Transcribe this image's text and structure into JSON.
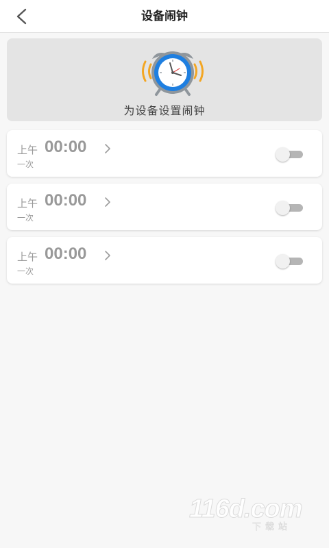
{
  "header": {
    "title": "设备闹钟",
    "back_icon": "chevron-left-icon"
  },
  "banner": {
    "icon": "alarm-clock-icon",
    "text": "为设备设置闹钟"
  },
  "alarms": [
    {
      "period": "上午",
      "time": "00:00",
      "repeat": "一次",
      "enabled": false
    },
    {
      "period": "上午",
      "time": "00:00",
      "repeat": "一次",
      "enabled": false
    },
    {
      "period": "上午",
      "time": "00:00",
      "repeat": "一次",
      "enabled": false
    }
  ],
  "watermark": {
    "main": "116d.com",
    "sub": "下载站"
  },
  "colors": {
    "background": "#f7f7f7",
    "banner": "#e4e4e4",
    "clock_blue": "#1f7fe0",
    "clock_ring_gray": "#8f969c",
    "vibration_orange": "#f3a623",
    "text_muted": "#999999"
  }
}
